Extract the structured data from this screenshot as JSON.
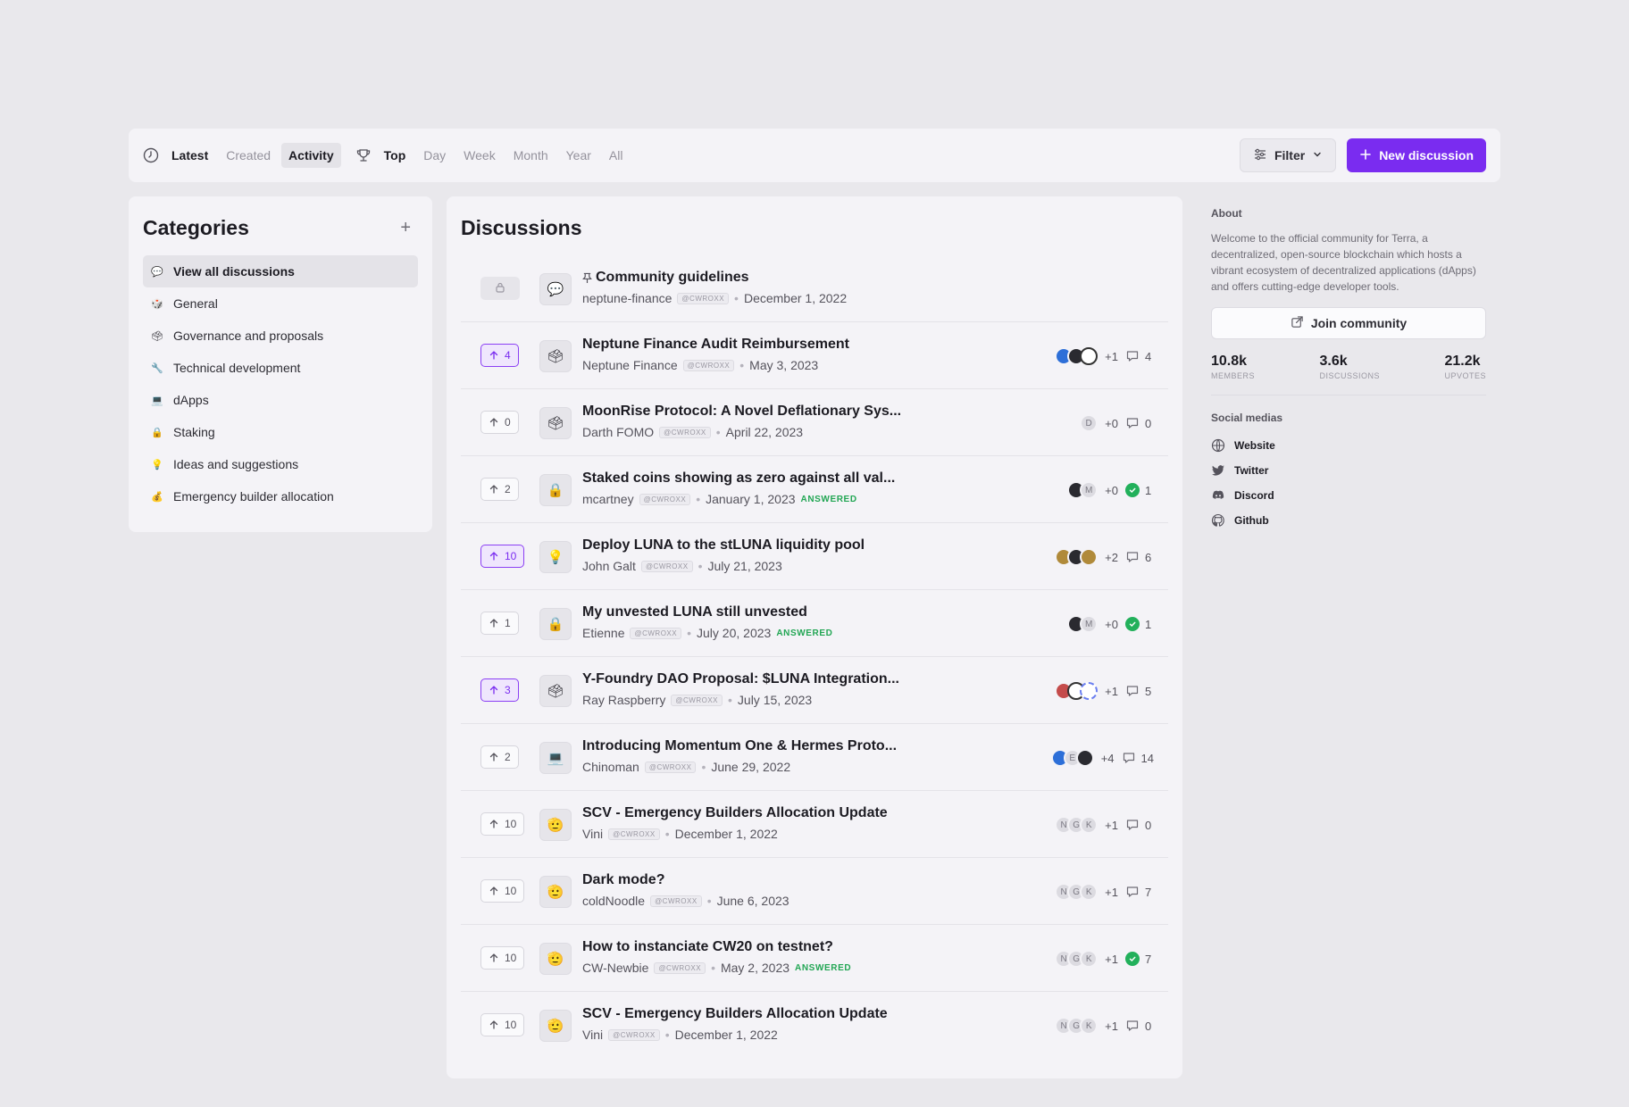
{
  "toolbar": {
    "latest": "Latest",
    "created": "Created",
    "activity": "Activity",
    "top": "Top",
    "day": "Day",
    "week": "Week",
    "month": "Month",
    "year": "Year",
    "all": "All",
    "filter": "Filter",
    "new_discussion": "New discussion"
  },
  "categories": {
    "title": "Categories",
    "items": [
      {
        "label": "View all discussions",
        "icon": "💬"
      },
      {
        "label": "General",
        "icon": "🎲"
      },
      {
        "label": "Governance and proposals",
        "icon": "🗳"
      },
      {
        "label": "Technical development",
        "icon": "🔧"
      },
      {
        "label": "dApps",
        "icon": "💻"
      },
      {
        "label": "Staking",
        "icon": "🔒"
      },
      {
        "label": "Ideas and suggestions",
        "icon": "💡"
      },
      {
        "label": "Emergency builder allocation",
        "icon": "💰"
      }
    ]
  },
  "discussions": {
    "title": "Discussions",
    "tag": "@CWROXX",
    "answered": "ANSWERED",
    "rows": [
      {
        "vote": "",
        "active": false,
        "icon": "💬",
        "title": "Community guidelines",
        "pinned": true,
        "author": "neptune-finance",
        "date": "December 1, 2022",
        "answered": false,
        "plus": "",
        "count": "",
        "comment": "none",
        "avatars": []
      },
      {
        "vote": "4",
        "active": true,
        "icon": "🗳",
        "title": "Neptune Finance Audit Reimbursement",
        "author": "Neptune Finance",
        "date": "May 3, 2023",
        "answered": false,
        "plus": "+1",
        "count": "4",
        "comment": "bubble",
        "avatars": [
          "blue",
          "dark",
          "ring"
        ]
      },
      {
        "vote": "0",
        "active": false,
        "icon": "🗳",
        "title": "MoonRise Protocol: A Novel Deflationary Sys...",
        "author": "Darth FOMO",
        "date": "April 22, 2023",
        "answered": false,
        "plus": "+0",
        "count": "0",
        "comment": "bubble",
        "avatars": [
          "D"
        ]
      },
      {
        "vote": "2",
        "active": false,
        "icon": "🔒",
        "title": "Staked coins showing as zero against all val...",
        "author": "mcartney",
        "date": "January 1, 2023",
        "answered": true,
        "plus": "+0",
        "count": "1",
        "comment": "check",
        "avatars": [
          "dark",
          "M"
        ]
      },
      {
        "vote": "10",
        "active": true,
        "icon": "💡",
        "title": "Deploy LUNA to the stLUNA liquidity pool",
        "author": "John Galt",
        "date": "July 21, 2023",
        "answered": false,
        "plus": "+2",
        "count": "6",
        "comment": "bubble",
        "avatars": [
          "gold",
          "dark",
          "gold"
        ]
      },
      {
        "vote": "1",
        "active": false,
        "icon": "🔒",
        "title": "My unvested LUNA still unvested",
        "author": "Etienne",
        "date": "July 20, 2023",
        "answered": true,
        "plus": "+0",
        "count": "1",
        "comment": "check",
        "avatars": [
          "dark",
          "M"
        ]
      },
      {
        "vote": "3",
        "active": true,
        "icon": "🗳",
        "title": "Y-Foundry DAO Proposal: $LUNA Integration...",
        "author": "Ray Raspberry",
        "date": "July 15, 2023",
        "answered": false,
        "plus": "+1",
        "count": "5",
        "comment": "bubble",
        "avatars": [
          "red",
          "ring",
          "dash"
        ]
      },
      {
        "vote": "2",
        "active": false,
        "icon": "💻",
        "title": "Introducing Momentum One & Hermes Proto...",
        "author": "Chinoman",
        "date": "June 29, 2022",
        "answered": false,
        "plus": "+4",
        "count": "14",
        "comment": "bubble",
        "avatars": [
          "blue",
          "E",
          "dark"
        ]
      },
      {
        "vote": "10",
        "active": false,
        "icon": "🫡",
        "title": "SCV - Emergency Builders Allocation Update",
        "author": "Vini",
        "date": "December 1, 2022",
        "answered": false,
        "plus": "+1",
        "count": "0",
        "comment": "bubble",
        "avatars": [
          "N",
          "G",
          "K"
        ]
      },
      {
        "vote": "10",
        "active": false,
        "icon": "🫡",
        "title": "Dark mode?",
        "author": "coldNoodle",
        "date": "June 6, 2023",
        "answered": false,
        "plus": "+1",
        "count": "7",
        "comment": "bubble",
        "avatars": [
          "N",
          "G",
          "K"
        ]
      },
      {
        "vote": "10",
        "active": false,
        "icon": "🫡",
        "title": "How to instanciate CW20 on testnet?",
        "author": "CW-Newbie",
        "date": "May 2, 2023",
        "answered": true,
        "plus": "+1",
        "count": "7",
        "comment": "check",
        "avatars": [
          "N",
          "G",
          "K"
        ]
      },
      {
        "vote": "10",
        "active": false,
        "icon": "🫡",
        "title": "SCV - Emergency Builders Allocation Update",
        "author": "Vini",
        "date": "December 1, 2022",
        "answered": false,
        "plus": "+1",
        "count": "0",
        "comment": "bubble",
        "avatars": [
          "N",
          "G",
          "K"
        ]
      }
    ]
  },
  "about": {
    "heading": "About",
    "description": "Welcome to the official community for Terra, a decentralized, open-source blockchain which hosts a vibrant ecosystem of decentralized applications (dApps) and offers cutting-edge developer tools.",
    "join": "Join community",
    "stats": [
      {
        "value": "10.8k",
        "label": "MEMBERS"
      },
      {
        "value": "3.6k",
        "label": "DISCUSSIONS"
      },
      {
        "value": "21.2k",
        "label": "UPVOTES"
      }
    ],
    "social_heading": "Social medias",
    "social": [
      {
        "label": "Website",
        "icon": "globe-icon"
      },
      {
        "label": "Twitter",
        "icon": "twitter-icon"
      },
      {
        "label": "Discord",
        "icon": "discord-icon"
      },
      {
        "label": "Github",
        "icon": "github-icon"
      }
    ]
  },
  "colors": {
    "accent": "#7a2cf0",
    "answered": "#22a654",
    "background": "#e9e8ec",
    "panel": "#f4f3f7"
  }
}
